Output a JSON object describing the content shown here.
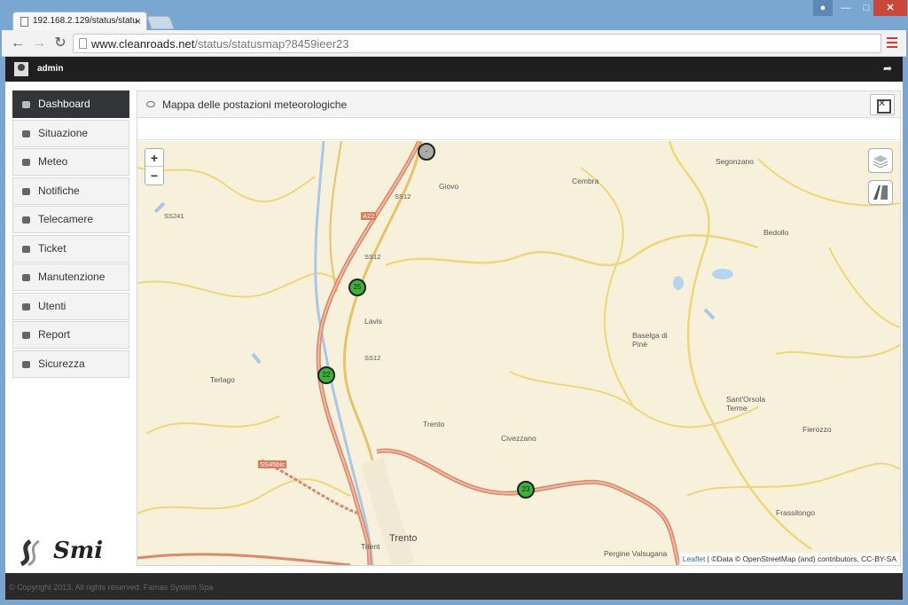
{
  "browser": {
    "tab_title": "192.168.2.129/status/statu",
    "close_glyph": "×",
    "url_host": "www.cleanroads.net",
    "url_path": "/status/statusmap?8459ieer23",
    "back_glyph": "←",
    "forward_glyph": "→",
    "reload_glyph": "↻",
    "min_glyph": "—",
    "max_glyph": "□",
    "close_win_glyph": "✕"
  },
  "topnav": {
    "username": "admin",
    "logout_glyph": "➦"
  },
  "sidebar": {
    "items": [
      {
        "label": "Dashboard",
        "icon": "dashboard-icon",
        "active": true
      },
      {
        "label": "Situazione",
        "icon": "map-pin-icon"
      },
      {
        "label": "Meteo",
        "icon": "cloud-icon"
      },
      {
        "label": "Notifiche",
        "icon": "warning-icon"
      },
      {
        "label": "Telecamere",
        "icon": "camera-icon"
      },
      {
        "label": "Ticket",
        "icon": "ticket-icon"
      },
      {
        "label": "Manutenzione",
        "icon": "wrench-icon"
      },
      {
        "label": "Utenti",
        "icon": "users-icon"
      },
      {
        "label": "Report",
        "icon": "chart-icon"
      },
      {
        "label": "Sicurezza",
        "icon": "lock-icon"
      }
    ]
  },
  "logo": {
    "text": "Smi"
  },
  "panel": {
    "title": "Mappa delle postazioni meteorologiche"
  },
  "map": {
    "zoom_in": "+",
    "zoom_out": "−",
    "places": [
      "Giovo",
      "Cembra",
      "Segonzano",
      "Bedollo",
      "Lavis",
      "Baselga di Pinè",
      "Terlago",
      "Trento",
      "Sant'Orsola Terme",
      "Fierozzo",
      "Civezzano",
      "Frassilongo",
      "Pergine Valsugana",
      "Trento",
      "Trient"
    ],
    "roads": [
      "A22",
      "SS12",
      "SS12",
      "SS12",
      "SS45bis",
      "SS241"
    ],
    "markers": [
      "-",
      "25",
      "22",
      "23"
    ],
    "attribution_link": "Leaflet",
    "attribution_text": " | ©Data © OpenStreetMap (and) contributors, CC-BY-SA"
  },
  "footer": {
    "copyright": "© Copyright 2013. All rights reserved. Famas System Spa"
  }
}
